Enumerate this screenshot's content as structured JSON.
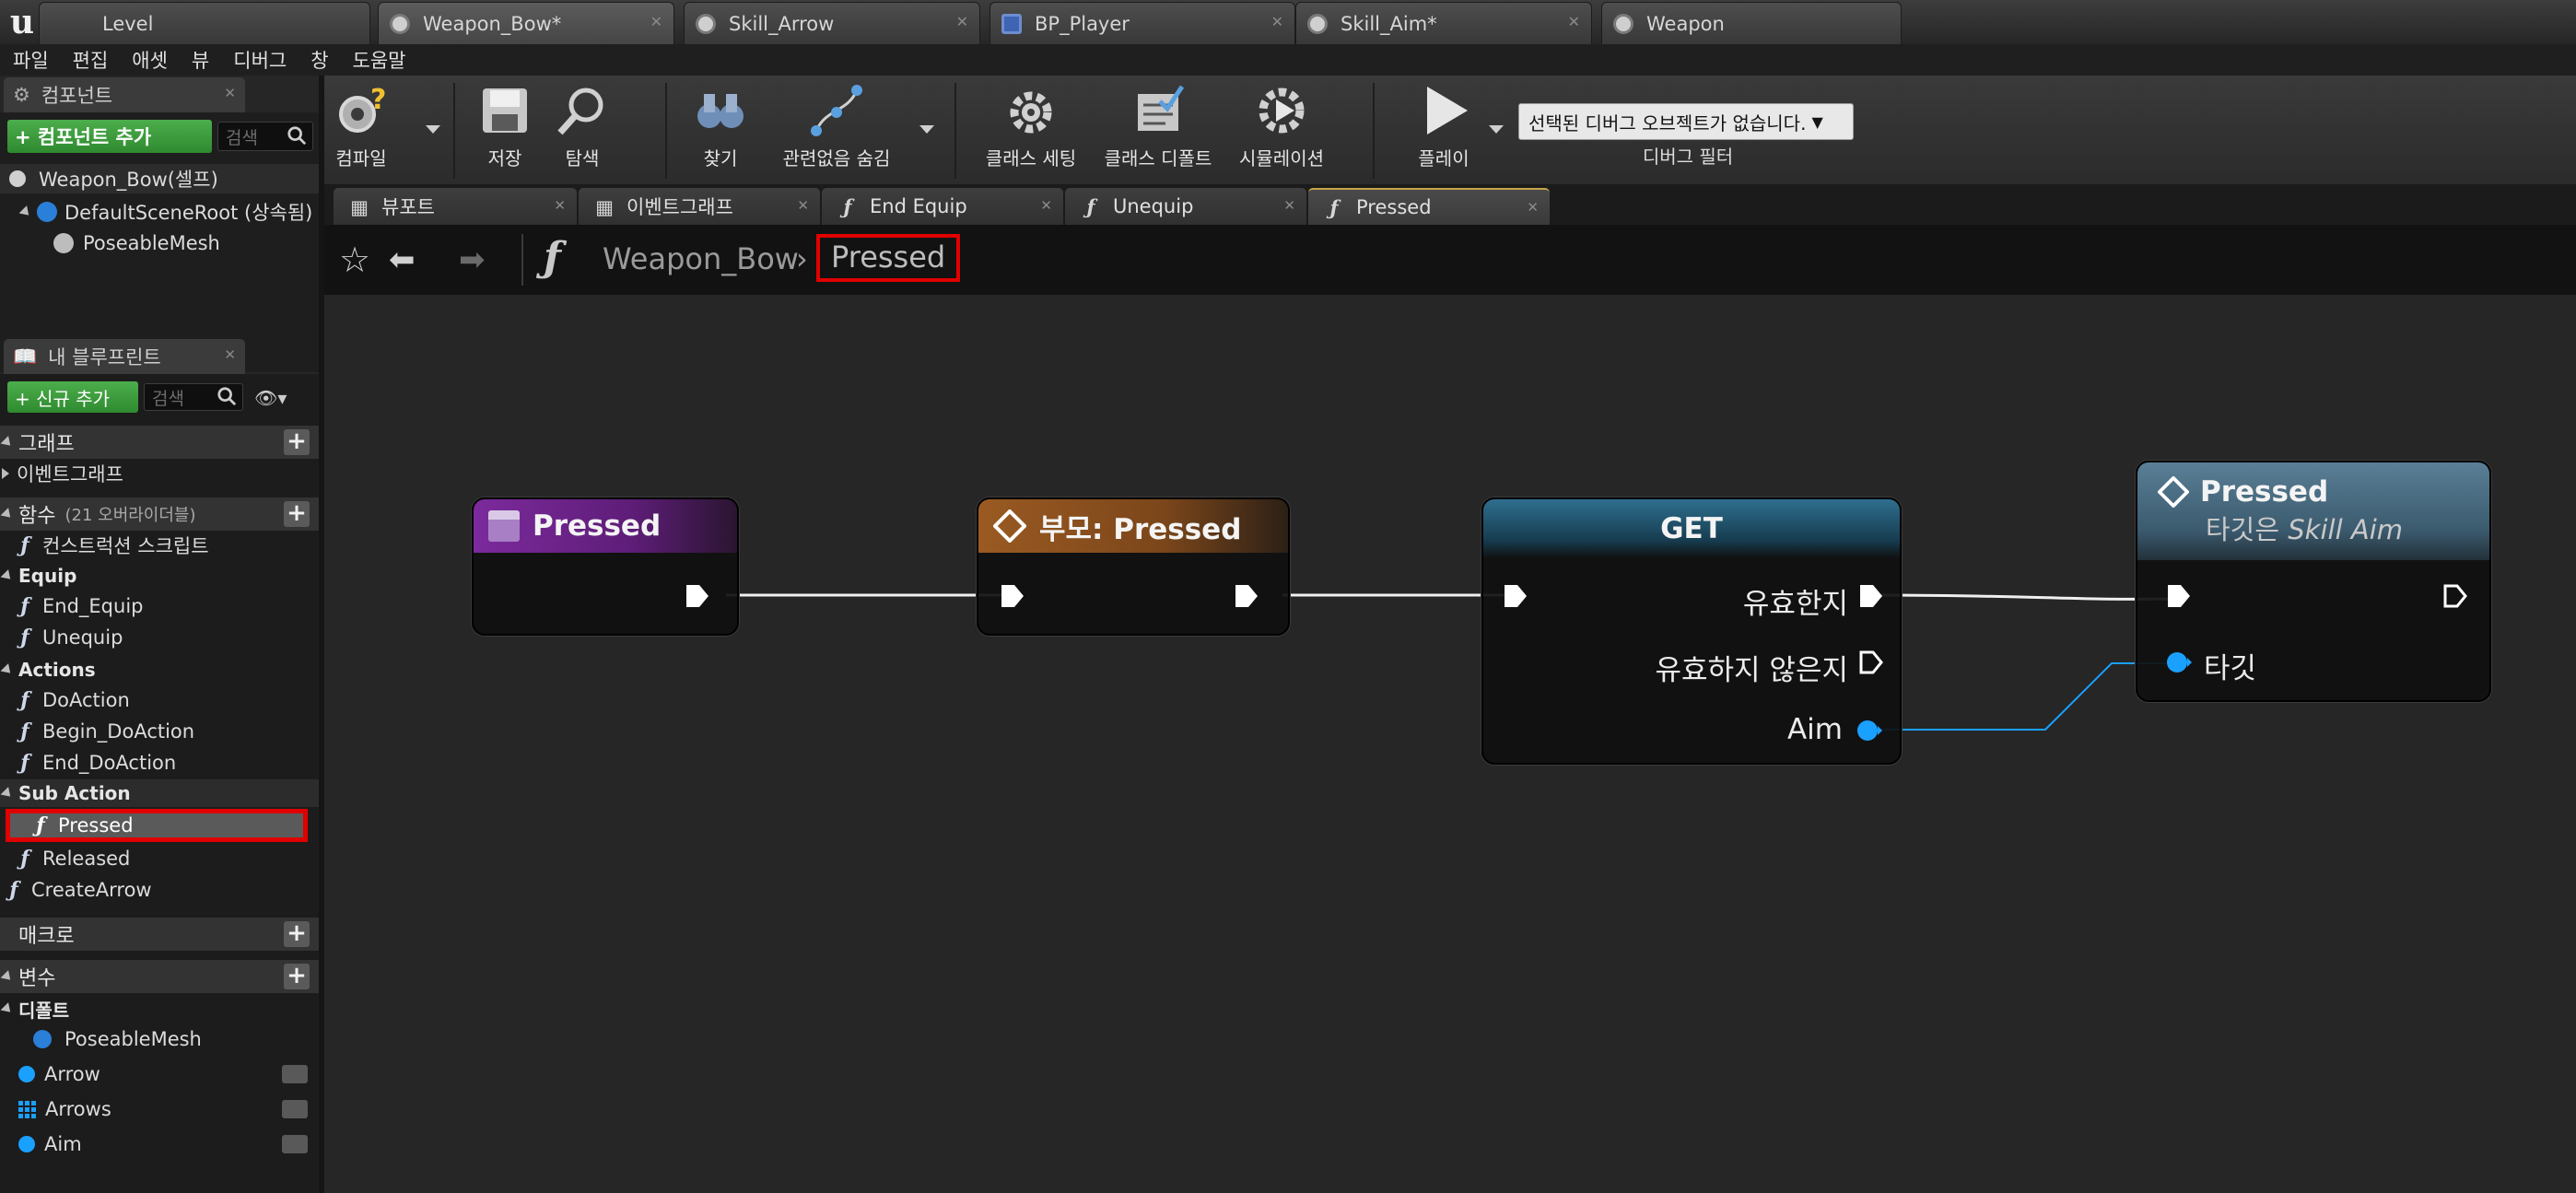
{
  "window": {
    "tabs": [
      {
        "label": "Level",
        "icon": "level-icon"
      },
      {
        "label": "Weapon_Bow*",
        "icon": "blueprint-icon",
        "active": true
      },
      {
        "label": "Skill_Arrow",
        "icon": "blueprint-icon"
      },
      {
        "label": "BP_Player",
        "icon": "person-icon"
      },
      {
        "label": "Skill_Aim*",
        "icon": "blueprint-icon"
      },
      {
        "label": "Weapon",
        "icon": "blueprint-icon"
      }
    ]
  },
  "menu": [
    "파일",
    "편집",
    "애셋",
    "뷰",
    "디버그",
    "창",
    "도움말"
  ],
  "components_panel": {
    "tab_label": "컴포넌트",
    "add_button": "+ 컴포넌트 추가",
    "search_placeholder": "검색",
    "self_item": "Weapon_Bow(셀프)",
    "root_item": "DefaultSceneRoot (상속됨)",
    "child_item": "PoseableMesh"
  },
  "my_blueprint": {
    "tab_label": "내 블루프린트",
    "add_new_button": "+ 신규 추가",
    "search_placeholder": "검색",
    "graph_category": "그래프",
    "event_graph": "이벤트그래프",
    "functions_category": "함수",
    "functions_override_count": "(21 오버라이더블)",
    "construction_script": "컨스트럭션 스크립트",
    "groups": [
      {
        "name": "Equip",
        "items": [
          "End_Equip",
          "Unequip"
        ]
      },
      {
        "name": "Actions",
        "items": [
          "DoAction",
          "Begin_DoAction",
          "End_DoAction"
        ]
      },
      {
        "name": "Sub Action",
        "items": [
          "Pressed",
          "Released"
        ]
      }
    ],
    "ungrouped_function": "CreateArrow",
    "macros_category": "매크로",
    "variables_category": "변수",
    "default_category": "디폴트",
    "variables": [
      {
        "name": "PoseableMesh",
        "type": "component"
      },
      {
        "name": "Arrow",
        "type": "object"
      },
      {
        "name": "Arrows",
        "type": "array"
      },
      {
        "name": "Aim",
        "type": "object"
      }
    ],
    "selected_function": "Pressed"
  },
  "toolbar": {
    "compile": "컴파일",
    "save": "저장",
    "browse": "탐색",
    "find": "찾기",
    "hide_unrelated": "관련없음 숨김",
    "class_settings": "클래스 세팅",
    "class_defaults": "클래스 디폴트",
    "simulation": "시뮬레이션",
    "play": "플레이",
    "debug_object": "선택된 디버그 오브젝트가 없습니다.",
    "debug_filter": "디버그 필터"
  },
  "graph_tabs": [
    {
      "label": "뷰포트",
      "icon": "viewport-icon"
    },
    {
      "label": "이벤트그래프",
      "icon": "eventgraph-icon"
    },
    {
      "label": "End Equip",
      "icon": "function-icon"
    },
    {
      "label": "Unequip",
      "icon": "function-icon"
    },
    {
      "label": "Pressed",
      "icon": "function-icon",
      "active": true
    }
  ],
  "breadcrumb": {
    "parent": "Weapon_Bow",
    "current": "Pressed"
  },
  "nodes": {
    "entry": {
      "title": "Pressed",
      "color": "#7c2a9c"
    },
    "parent_call": {
      "title": "부모: Pressed",
      "color": "#9a5a22"
    },
    "get": {
      "title": "GET",
      "valid": "유효한지",
      "not_valid": "유효하지 않은지",
      "input": "Aim",
      "color": "#2f6f8f"
    },
    "call": {
      "title": "Pressed",
      "subtitle_prefix": "타깃은 ",
      "subtitle_target": "Skill Aim",
      "target_pin": "타깃",
      "color": "#5a7f96"
    }
  },
  "colors": {
    "highlight": "#e00000",
    "object_pin": "#1aa0ff",
    "exec_pin": "#ffffff"
  }
}
